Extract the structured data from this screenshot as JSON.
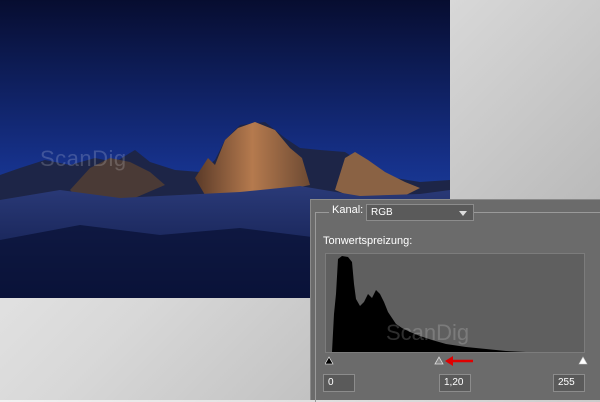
{
  "watermark": "ScanDig",
  "levels_panel": {
    "channel_label": "Kanal:",
    "channel_value": "RGB",
    "input_levels_label": "Tonwertspreizung:",
    "black_point": "0",
    "gamma": "1,20",
    "white_point": "255"
  },
  "colors": {
    "sky_top": "#0a1135",
    "sky_bottom": "#1b3f9e",
    "panel_bg": "#6b6b6b",
    "arrow": "#e00000"
  },
  "icons": {
    "black_slider": "black-point-triangle-icon",
    "gray_slider": "midtone-triangle-icon",
    "white_slider": "white-point-triangle-icon",
    "pointer": "red-arrow-icon",
    "dropdown": "chevron-down-icon"
  }
}
